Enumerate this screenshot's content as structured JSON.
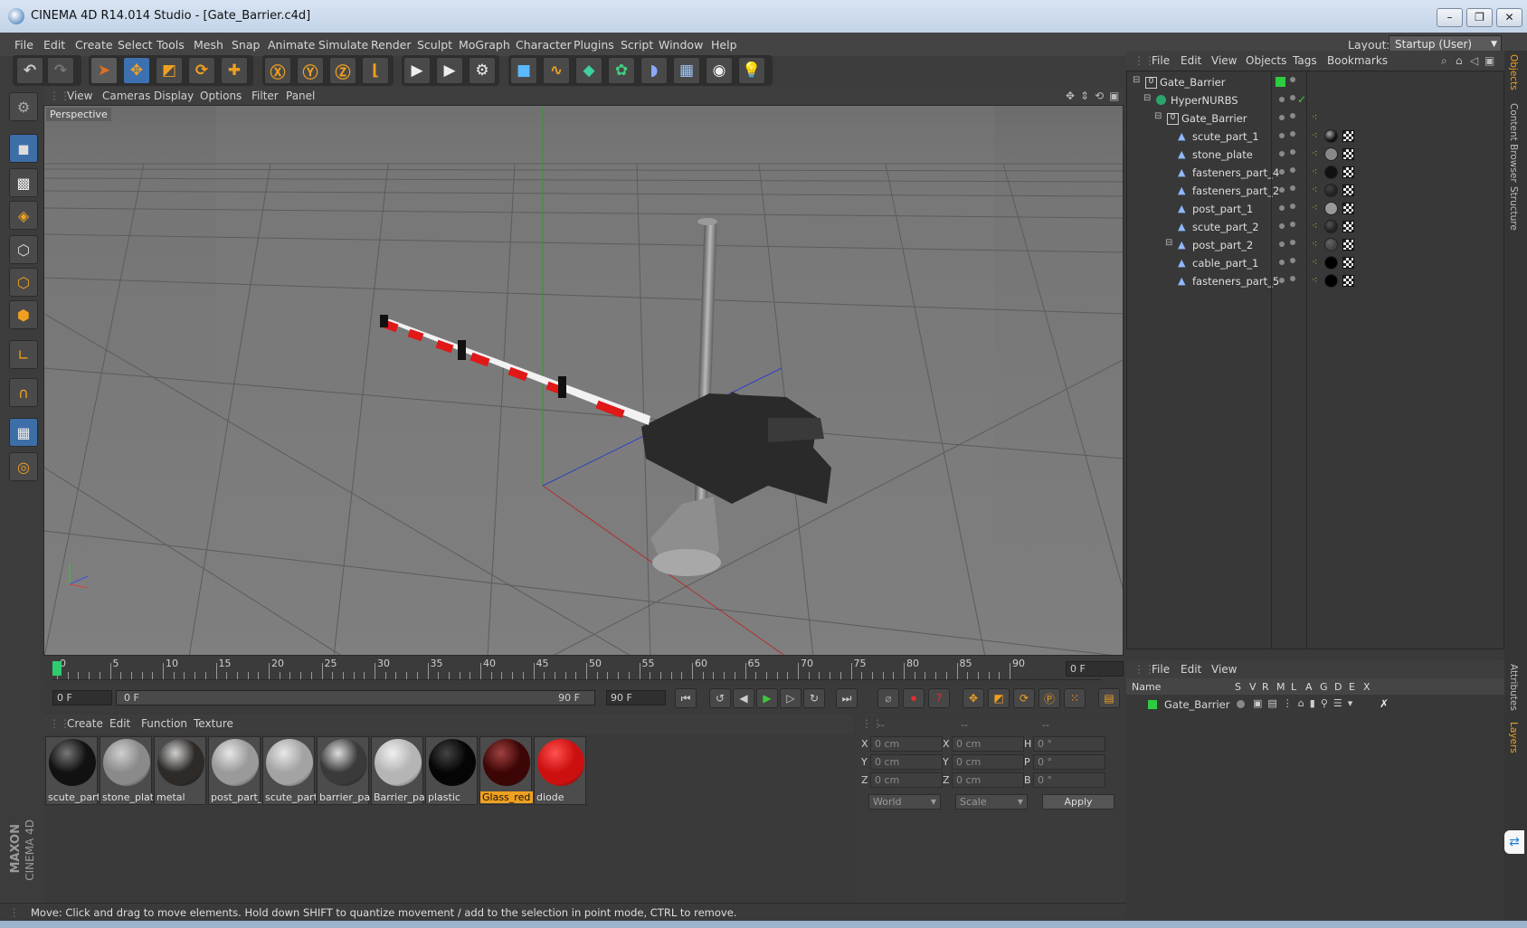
{
  "window": {
    "title": "CINEMA 4D R14.014 Studio - [Gate_Barrier.c4d]",
    "minimize": "–",
    "restore": "❐",
    "close": "✕"
  },
  "menu": [
    "File",
    "Edit",
    "Create",
    "Select",
    "Tools",
    "Mesh",
    "Snap",
    "Animate",
    "Simulate",
    "Render",
    "Sculpt",
    "MoGraph",
    "Character",
    "Plugins",
    "Script",
    "Window",
    "Help"
  ],
  "layout": {
    "label": "Layout:",
    "value": "Startup (User)"
  },
  "viewport": {
    "menu": [
      "View",
      "Cameras",
      "Display",
      "Options",
      "Filter",
      "Panel"
    ],
    "camera_label": "Perspective"
  },
  "timeline": {
    "ticks": [
      "0",
      "5",
      "10",
      "15",
      "20",
      "25",
      "30",
      "35",
      "40",
      "45",
      "50",
      "55",
      "60",
      "65",
      "70",
      "75",
      "80",
      "85",
      "90"
    ],
    "current_frame": "0 F",
    "start_frame": "0 F",
    "range_start": "0 F",
    "range_end": "90 F",
    "end_frame": "90 F"
  },
  "material_manager": {
    "menu": [
      "Create",
      "Edit",
      "Function",
      "Texture"
    ],
    "materials": [
      {
        "name": "scute_part_",
        "color": "#111111",
        "highlight": "#777777"
      },
      {
        "name": "stone_plate",
        "color": "#8a8a8a",
        "highlight": "#cfcfcf"
      },
      {
        "name": "metal",
        "color": "#2d2a28",
        "highlight": "#d0d0d0"
      },
      {
        "name": "post_part_",
        "color": "#9a9a9a",
        "highlight": "#e6e6e6"
      },
      {
        "name": "scute_part_",
        "color": "#a3a3a3",
        "highlight": "#e8e8e8"
      },
      {
        "name": "barrier_par",
        "color": "#3a3a3a",
        "highlight": "#dddddd"
      },
      {
        "name": "Barrier_par",
        "color": "#b5b5b5",
        "highlight": "#f0f0f0"
      },
      {
        "name": "plastic",
        "color": "#050505",
        "highlight": "#444444"
      },
      {
        "name": "Glass_red",
        "color": "#3d0606",
        "highlight": "#a04040"
      },
      {
        "name": "diode",
        "color": "#cc1010",
        "highlight": "#ff5050"
      }
    ],
    "selected_index": 8
  },
  "coordinates": {
    "headers": [
      "--",
      "--",
      "--"
    ],
    "rows": [
      {
        "pos_label": "X",
        "pos": "0 cm",
        "size_label": "X",
        "size": "0 cm",
        "rot_label": "H",
        "rot": "0 °"
      },
      {
        "pos_label": "Y",
        "pos": "0 cm",
        "size_label": "Y",
        "size": "0 cm",
        "rot_label": "P",
        "rot": "0 °"
      },
      {
        "pos_label": "Z",
        "pos": "0 cm",
        "size_label": "Z",
        "size": "0 cm",
        "rot_label": "B",
        "rot": "0 °"
      }
    ],
    "space": "World",
    "mode": "Scale",
    "apply": "Apply"
  },
  "status_text": "Move: Click and drag to move elements. Hold down SHIFT to quantize movement / add to the selection in point mode, CTRL to remove.",
  "object_manager": {
    "menu": [
      "File",
      "Edit",
      "View",
      "Objects",
      "Tags",
      "Bookmarks"
    ],
    "objects": [
      {
        "name": "Gate_Barrier",
        "depth": 0,
        "type": "null"
      },
      {
        "name": "HyperNURBS",
        "depth": 1,
        "type": "nurbs"
      },
      {
        "name": "Gate_Barrier",
        "depth": 2,
        "type": "null"
      },
      {
        "name": "scute_part_1",
        "depth": 3,
        "type": "poly"
      },
      {
        "name": "stone_plate",
        "depth": 3,
        "type": "poly"
      },
      {
        "name": "fasteners_part_4",
        "depth": 3,
        "type": "poly"
      },
      {
        "name": "fasteners_part_2",
        "depth": 3,
        "type": "poly"
      },
      {
        "name": "post_part_1",
        "depth": 3,
        "type": "poly"
      },
      {
        "name": "scute_part_2",
        "depth": 3,
        "type": "poly"
      },
      {
        "name": "post_part_2",
        "depth": 3,
        "type": "poly"
      },
      {
        "name": "cable_part_1",
        "depth": 3,
        "type": "poly"
      },
      {
        "name": "fasteners_part_5",
        "depth": 3,
        "type": "poly"
      }
    ]
  },
  "layer_manager": {
    "menu": [
      "File",
      "Edit",
      "View"
    ],
    "columns": [
      "Name",
      "S",
      "V",
      "R",
      "M",
      "L",
      "A",
      "G",
      "D",
      "E",
      "X"
    ],
    "layers": [
      {
        "name": "Gate_Barrier",
        "color": "#2ecc40"
      }
    ]
  },
  "right_tabs": [
    "Objects",
    "Content Browser",
    "Structure",
    "Attributes",
    "Layers"
  ],
  "branding": {
    "line1": "MAXON",
    "line2": "CINEMA 4D"
  }
}
